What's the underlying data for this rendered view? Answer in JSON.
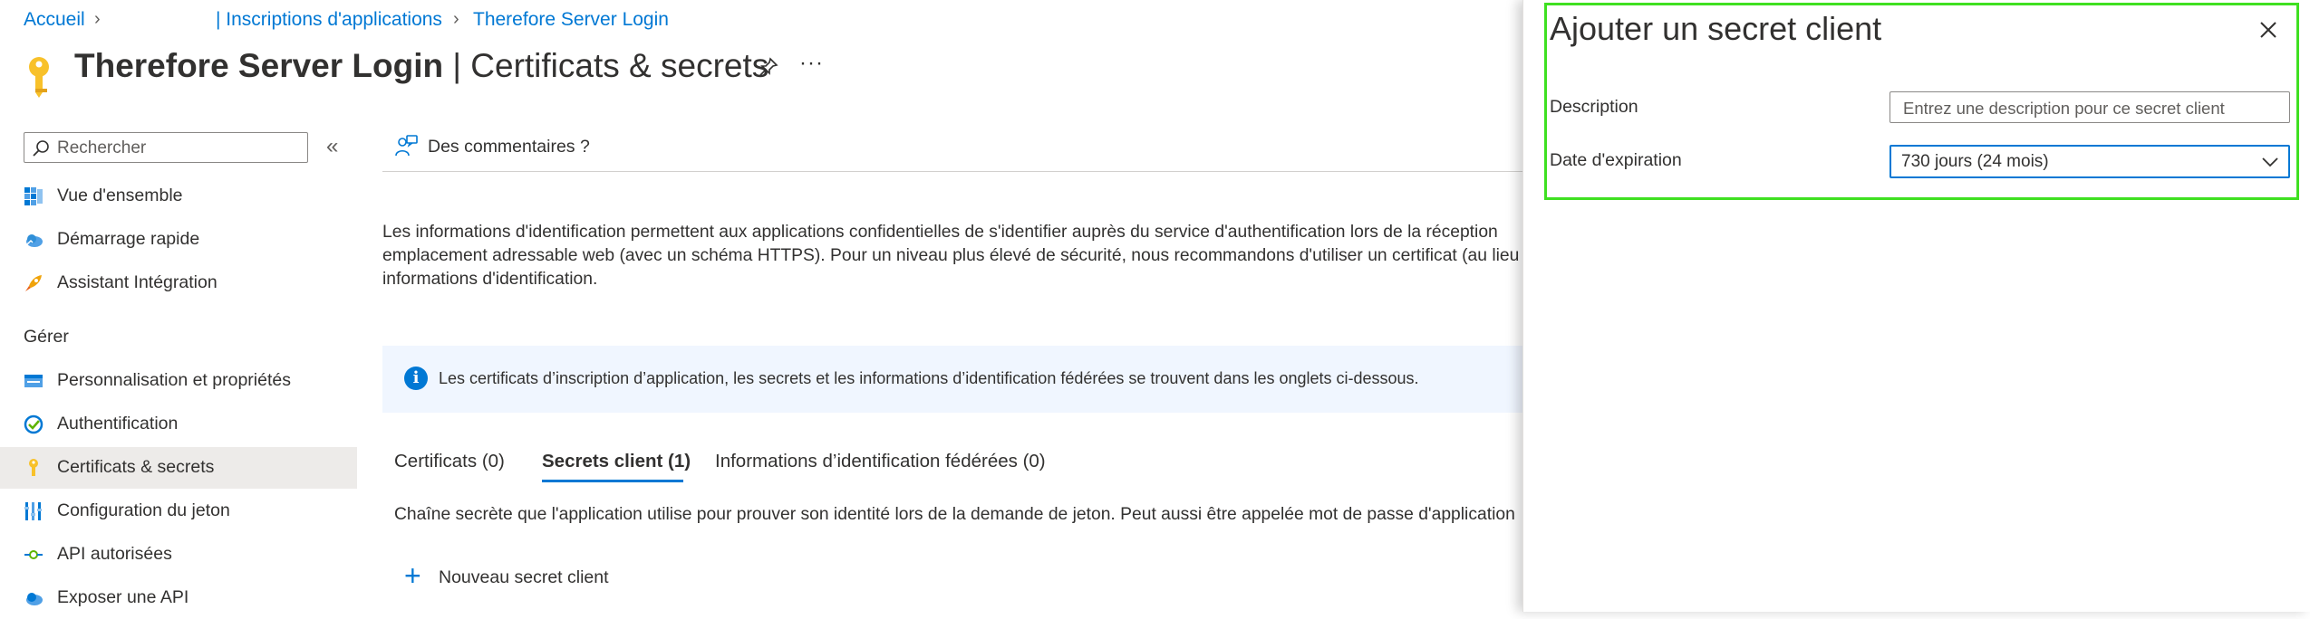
{
  "breadcrumb": {
    "home": "Accueil",
    "app_registrations": "| Inscriptions d'applications",
    "app": "Therefore Server Login"
  },
  "header": {
    "app_name": "Therefore Server Login",
    "section": " | Certificats & secrets",
    "icon": "key-icon"
  },
  "sidebar": {
    "search_placeholder": "Rechercher",
    "items": [
      {
        "label": "Vue d'ensemble",
        "icon": "overview-grid-icon"
      },
      {
        "label": "Démarrage rapide",
        "icon": "cloud-quickstart-icon"
      },
      {
        "label": "Assistant Intégration",
        "icon": "rocket-icon"
      }
    ],
    "manage_label": "Gérer",
    "manage_items": [
      {
        "label": "Personnalisation et propriétés",
        "icon": "branding-icon"
      },
      {
        "label": "Authentification",
        "icon": "authentication-icon"
      },
      {
        "label": "Certificats & secrets",
        "icon": "key-icon",
        "selected": true
      },
      {
        "label": "Configuration du jeton",
        "icon": "token-bars-icon"
      },
      {
        "label": "API autorisées",
        "icon": "api-permissions-icon"
      },
      {
        "label": "Exposer une API",
        "icon": "cloud-api-icon"
      }
    ]
  },
  "main": {
    "feedback": "Des commentaires ?",
    "description_lines": [
      "Les informations d'identification permettent aux applications confidentielles de s'identifier auprès du service d'authentification lors de la réception",
      "emplacement adressable web (avec un schéma HTTPS). Pour un niveau plus élevé de sécurité, nous recommandons d'utiliser un certificat (au lieu d",
      "informations d'identification."
    ],
    "info_banner": "Les certificats d’inscription d’application, les secrets et les informations d’identification fédérées se trouvent dans les onglets ci-dessous.",
    "tabs": [
      {
        "label": "Certificats (0)",
        "active": false
      },
      {
        "label": "Secrets client (1)",
        "active": true
      },
      {
        "label": "Informations d’identification fédérées (0)",
        "active": false
      }
    ],
    "tab_caption": "Chaîne secrète que l'application utilise pour prouver son identité lors de la demande de jeton. Peut aussi être appelée mot de passe d'application",
    "new_secret": "Nouveau secret client"
  },
  "panel": {
    "title": "Ajouter un secret client",
    "description_label": "Description",
    "description_placeholder": "Entrez une description pour ce secret client",
    "description_value": "",
    "expiration_label": "Date d'expiration",
    "expiration_value": "730 jours (24 mois)"
  },
  "colors": {
    "accent": "#0078d4",
    "highlight_frame": "#3fe021",
    "selected_bg": "#edebe9",
    "info_bg": "#f0f6ff"
  }
}
